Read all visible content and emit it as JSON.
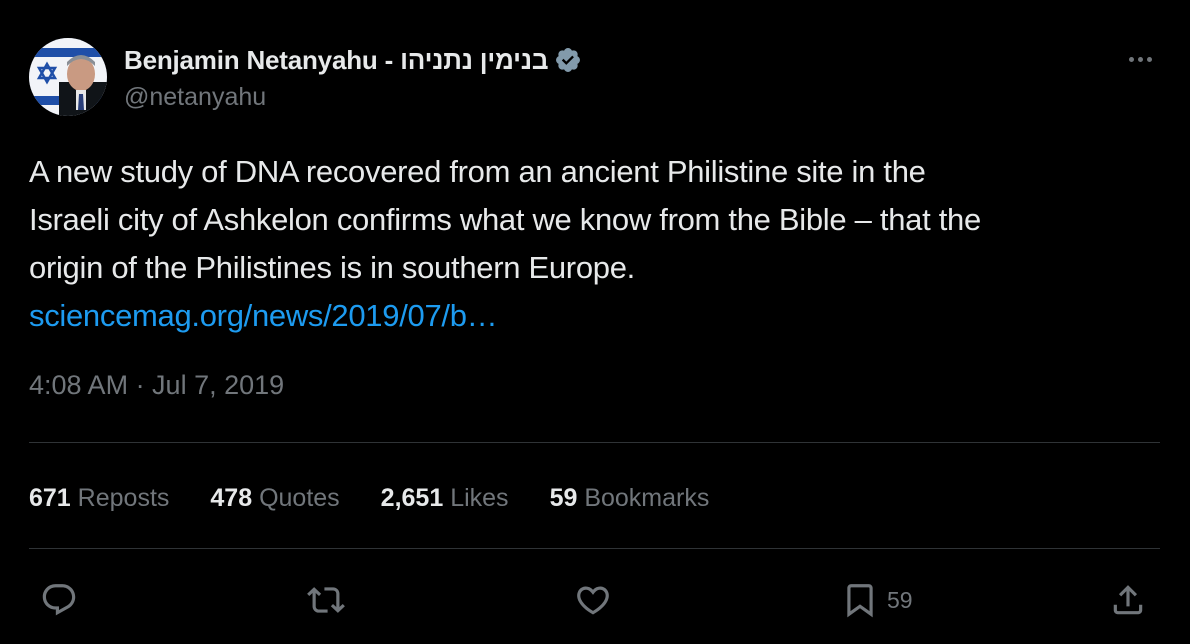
{
  "author": {
    "display_name": "Benjamin Netanyahu - בנימין נתניהו",
    "handle": "@netanyahu",
    "verified_color": "#829aab"
  },
  "tweet": {
    "text_lines": [
      "A new study of DNA recovered from an ancient Philistine site in the",
      "Israeli city of Ashkelon confirms what we know from the Bible – that the",
      "origin of the Philistines is in southern Europe."
    ],
    "link_text": "sciencemag.org/news/2019/07/b…",
    "timestamp": "4:08 AM · Jul 7, 2019"
  },
  "stats": {
    "reposts": {
      "count": "671",
      "label": "Reposts"
    },
    "quotes": {
      "count": "478",
      "label": "Quotes"
    },
    "likes": {
      "count": "2,651",
      "label": "Likes"
    },
    "bookmarks": {
      "count": "59",
      "label": "Bookmarks"
    }
  },
  "actions": {
    "reply_icon": "reply-icon",
    "repost_icon": "repost-icon",
    "like_icon": "heart-icon",
    "bookmark_icon": "bookmark-icon",
    "bookmark_count": "59",
    "share_icon": "share-icon"
  },
  "colors": {
    "background": "#000000",
    "text": "#e7e9ea",
    "muted": "#71767b",
    "link": "#1d9bf0",
    "divider": "#2f3336"
  }
}
